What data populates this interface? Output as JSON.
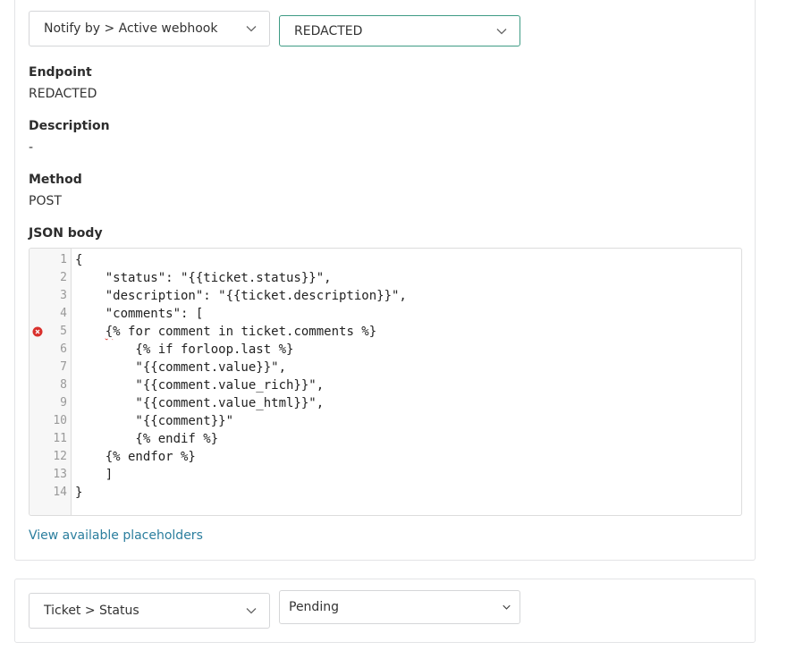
{
  "webhook_rule": {
    "condition_select": "Notify by > Active webhook",
    "value_select": "REDACTED",
    "endpoint": {
      "label": "Endpoint",
      "value": "REDACTED"
    },
    "description": {
      "label": "Description",
      "value": "-"
    },
    "method": {
      "label": "Method",
      "value": "POST"
    },
    "json_body": {
      "label": "JSON body",
      "error_line": 5,
      "lines": [
        {
          "n": "1",
          "text": "{"
        },
        {
          "n": "2",
          "text": "    \"status\": \"{{ticket.status}}\","
        },
        {
          "n": "3",
          "text": "    \"description\": \"{{ticket.description}}\","
        },
        {
          "n": "4",
          "text": "    \"comments\": ["
        },
        {
          "n": "5",
          "text": "    {% for comment in ticket.comments %}"
        },
        {
          "n": "6",
          "text": "        {% if forloop.last %}"
        },
        {
          "n": "7",
          "text": "        \"{{comment.value}}\","
        },
        {
          "n": "8",
          "text": "        \"{{comment.value_rich}}\","
        },
        {
          "n": "9",
          "text": "        \"{{comment.value_html}}\","
        },
        {
          "n": "10",
          "text": "        \"{{comment}}\""
        },
        {
          "n": "11",
          "text": "        {% endif %}"
        },
        {
          "n": "12",
          "text": "    {% endfor %}"
        },
        {
          "n": "13",
          "text": "    ]"
        },
        {
          "n": "14",
          "text": "}"
        }
      ]
    },
    "placeholders_link": "View available placeholders"
  },
  "status_rule": {
    "condition_select": "Ticket > Status",
    "value_select": "Pending"
  },
  "colors": {
    "accent_border": "#3e9b84",
    "link": "#2b7e9e",
    "error": "#d9302c"
  },
  "icons": {
    "dropdown": "chevron-down-icon",
    "error": "error-circle-icon"
  }
}
